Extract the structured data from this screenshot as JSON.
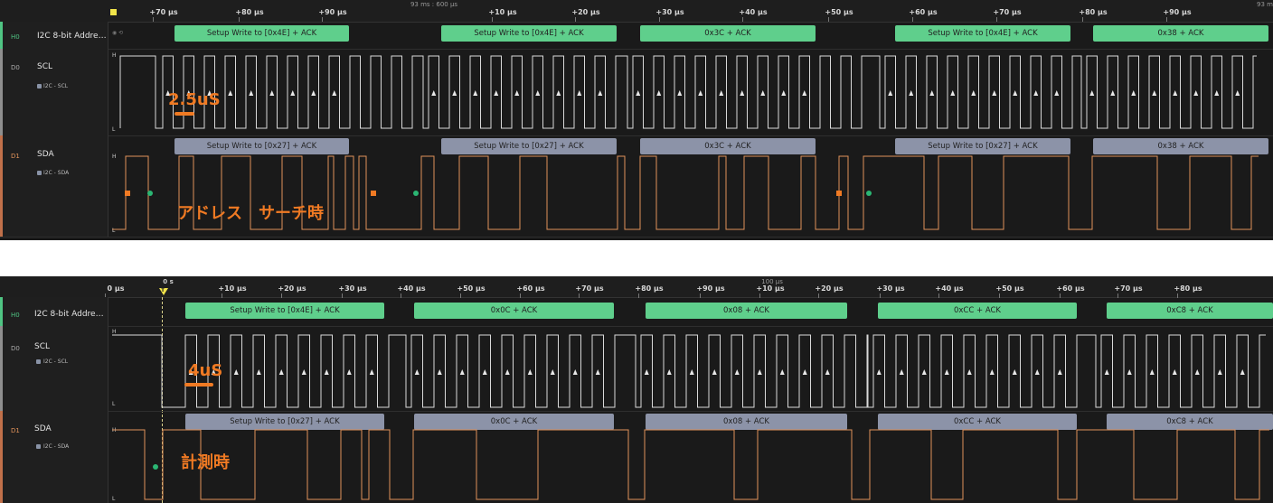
{
  "top": {
    "center_time": "93 ms : 600 µs",
    "right_edge_time": "93 m",
    "ticks": [
      "+70 µs",
      "+80 µs",
      "+90 µs",
      "+10 µs",
      "+20 µs",
      "+30 µs",
      "+40 µs",
      "+50 µs",
      "+60 µs",
      "+70 µs",
      "+80 µs",
      "+90 µs"
    ],
    "channels": {
      "h0": {
        "id": "H0",
        "name": "I2C 8-bit Addre…",
        "toggle": "◉ ⟲"
      },
      "d0": {
        "id": "D0",
        "name": "SCL",
        "sub": "I2C - SCL"
      },
      "d1": {
        "id": "D1",
        "name": "SDA",
        "sub": "I2C - SDA"
      }
    },
    "level_high": "H",
    "level_low": "L",
    "h0_boxes": [
      "Setup Write to [0x4E] + ACK",
      "Setup Write to [0x4E] + ACK",
      "0x3C + ACK",
      "Setup Write to [0x4E] + ACK",
      "0x38 + ACK"
    ],
    "sda_boxes": [
      "Setup Write to [0x27] + ACK",
      "Setup Write to [0x27] + ACK",
      "0x3C + ACK",
      "Setup Write to [0x27] + ACK",
      "0x38 + ACK"
    ],
    "annotation_period": "2.5uS",
    "annotation_mode": "アドレス　サーチ時"
  },
  "bottom": {
    "zero": "0 s",
    "cursor": "T",
    "center_time": "100 µs",
    "ticks": [
      "0 µs",
      "+10 µs",
      "+20 µs",
      "+30 µs",
      "+40 µs",
      "+50 µs",
      "+60 µs",
      "+70 µs",
      "+80 µs",
      "+90 µs",
      "+10 µs",
      "+20 µs",
      "+30 µs",
      "+40 µs",
      "+50 µs",
      "+60 µs",
      "+70 µs",
      "+80 µs"
    ],
    "channels": {
      "h0": {
        "id": "H0",
        "name": "I2C 8-bit Addre…"
      },
      "d0": {
        "id": "D0",
        "name": "SCL",
        "sub": "I2C - SCL"
      },
      "d1": {
        "id": "D1",
        "name": "SDA",
        "sub": "I2C - SDA"
      }
    },
    "level_high": "H",
    "level_low": "L",
    "h0_boxes": [
      "Setup Write to [0x4E] + ACK",
      "0x0C + ACK",
      "0x08 + ACK",
      "0xCC + ACK",
      "0xC8 + ACK"
    ],
    "sda_boxes": [
      "Setup Write to [0x27] + ACK",
      "0x0C + ACK",
      "0x08 + ACK",
      "0xCC + ACK",
      "0xC8 + ACK"
    ],
    "annotation_period": "4uS",
    "annotation_mode": "計測時"
  },
  "colors": {
    "scl_wave": "#d9d9d9",
    "sda_wave": "#e0925a",
    "h0_box": "#5fcf8c",
    "data_box": "#8c93a8",
    "annotation": "#f07a23",
    "start_marker": "#f07a23",
    "stop_marker": "#2bb673",
    "h0_stripe": "#4fc483",
    "d0_stripe": "#8e8e8e",
    "d1_stripe": "#c0704a"
  }
}
